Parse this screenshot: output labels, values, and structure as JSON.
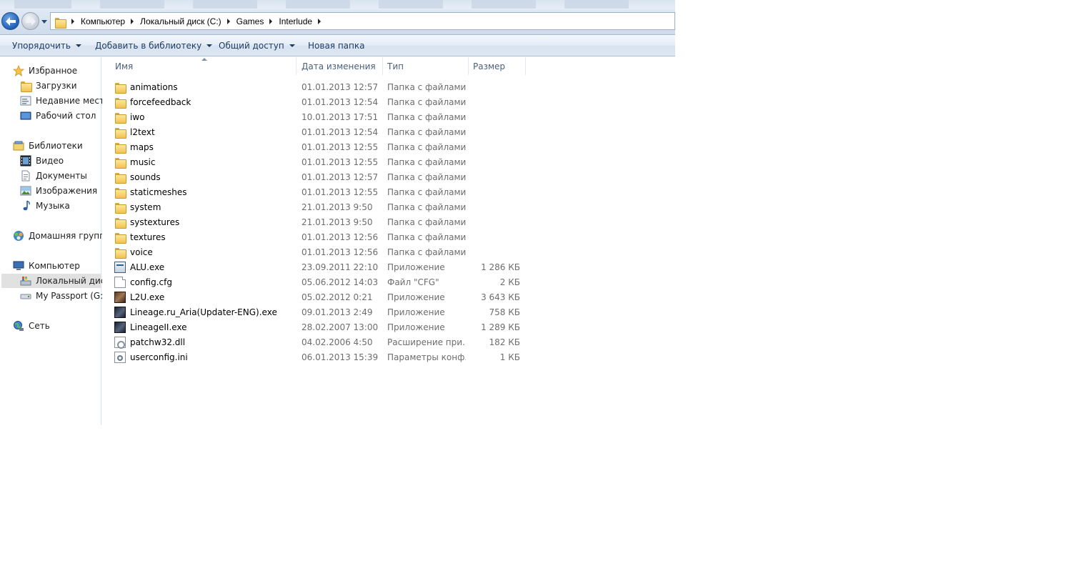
{
  "address": {
    "crumbs": [
      "Компьютер",
      "Локальный диск (C:)",
      "Games",
      "Interlude"
    ]
  },
  "toolbar": {
    "organize": "Упорядочить",
    "add_to_library": "Добавить в библиотеку",
    "share": "Общий доступ",
    "new_folder": "Новая папка"
  },
  "nav": {
    "favorites": "Избранное",
    "downloads": "Загрузки",
    "recent": "Недавние места",
    "desktop": "Рабочий стол",
    "libraries": "Библиотеки",
    "video": "Видео",
    "documents": "Документы",
    "pictures": "Изображения",
    "music": "Музыка",
    "homegroup": "Домашняя группа",
    "computer": "Компьютер",
    "local_disk": "Локальный диск",
    "passport": "My Passport (G:)",
    "network": "Сеть"
  },
  "columns": {
    "name": "Имя",
    "date": "Дата изменения",
    "type": "Тип",
    "size": "Размер"
  },
  "files": [
    {
      "name": "animations",
      "date": "01.01.2013 12:57",
      "type": "Папка с файлами",
      "size": "",
      "icon": "folder-icon"
    },
    {
      "name": "forcefeedback",
      "date": "01.01.2013 12:54",
      "type": "Папка с файлами",
      "size": "",
      "icon": "folder-icon"
    },
    {
      "name": "iwo",
      "date": "10.01.2013 17:51",
      "type": "Папка с файлами",
      "size": "",
      "icon": "folder-icon"
    },
    {
      "name": "l2text",
      "date": "01.01.2013 12:54",
      "type": "Папка с файлами",
      "size": "",
      "icon": "folder-icon"
    },
    {
      "name": "maps",
      "date": "01.01.2013 12:55",
      "type": "Папка с файлами",
      "size": "",
      "icon": "folder-icon"
    },
    {
      "name": "music",
      "date": "01.01.2013 12:55",
      "type": "Папка с файлами",
      "size": "",
      "icon": "folder-icon"
    },
    {
      "name": "sounds",
      "date": "01.01.2013 12:57",
      "type": "Папка с файлами",
      "size": "",
      "icon": "folder-icon"
    },
    {
      "name": "staticmeshes",
      "date": "01.01.2013 12:55",
      "type": "Папка с файлами",
      "size": "",
      "icon": "folder-icon"
    },
    {
      "name": "system",
      "date": "21.01.2013 9:50",
      "type": "Папка с файлами",
      "size": "",
      "icon": "folder-icon"
    },
    {
      "name": "systextures",
      "date": "21.01.2013 9:50",
      "type": "Папка с файлами",
      "size": "",
      "icon": "folder-icon"
    },
    {
      "name": "textures",
      "date": "01.01.2013 12:56",
      "type": "Папка с файлами",
      "size": "",
      "icon": "folder-icon"
    },
    {
      "name": "voice",
      "date": "01.01.2013 12:56",
      "type": "Папка с файлами",
      "size": "",
      "icon": "folder-icon"
    },
    {
      "name": "ALU.exe",
      "date": "23.09.2011 22:10",
      "type": "Приложение",
      "size": "1 286 КБ",
      "icon": "exe-icon"
    },
    {
      "name": "config.cfg",
      "date": "05.06.2012 14:03",
      "type": "Файл \"CFG\"",
      "size": "2 КБ",
      "icon": "document-icon"
    },
    {
      "name": "L2U.exe",
      "date": "05.02.2012 0:21",
      "type": "Приложение",
      "size": "3 643 КБ",
      "icon": "l2u-app-icon"
    },
    {
      "name": "Lineage.ru_Aria(Updater-ENG).exe",
      "date": "09.01.2013 2:49",
      "type": "Приложение",
      "size": "758 КБ",
      "icon": "lineage-app-icon"
    },
    {
      "name": "LineageII.exe",
      "date": "28.02.2007 13:00",
      "type": "Приложение",
      "size": "1 289 КБ",
      "icon": "lineage-app-icon"
    },
    {
      "name": "patchw32.dll",
      "date": "04.02.2006 4:50",
      "type": "Расширение при...",
      "size": "182 КБ",
      "icon": "dll-icon"
    },
    {
      "name": "userconfig.ini",
      "date": "06.01.2013 15:39",
      "type": "Параметры конф...",
      "size": "1 КБ",
      "icon": "settings-file-icon"
    }
  ]
}
